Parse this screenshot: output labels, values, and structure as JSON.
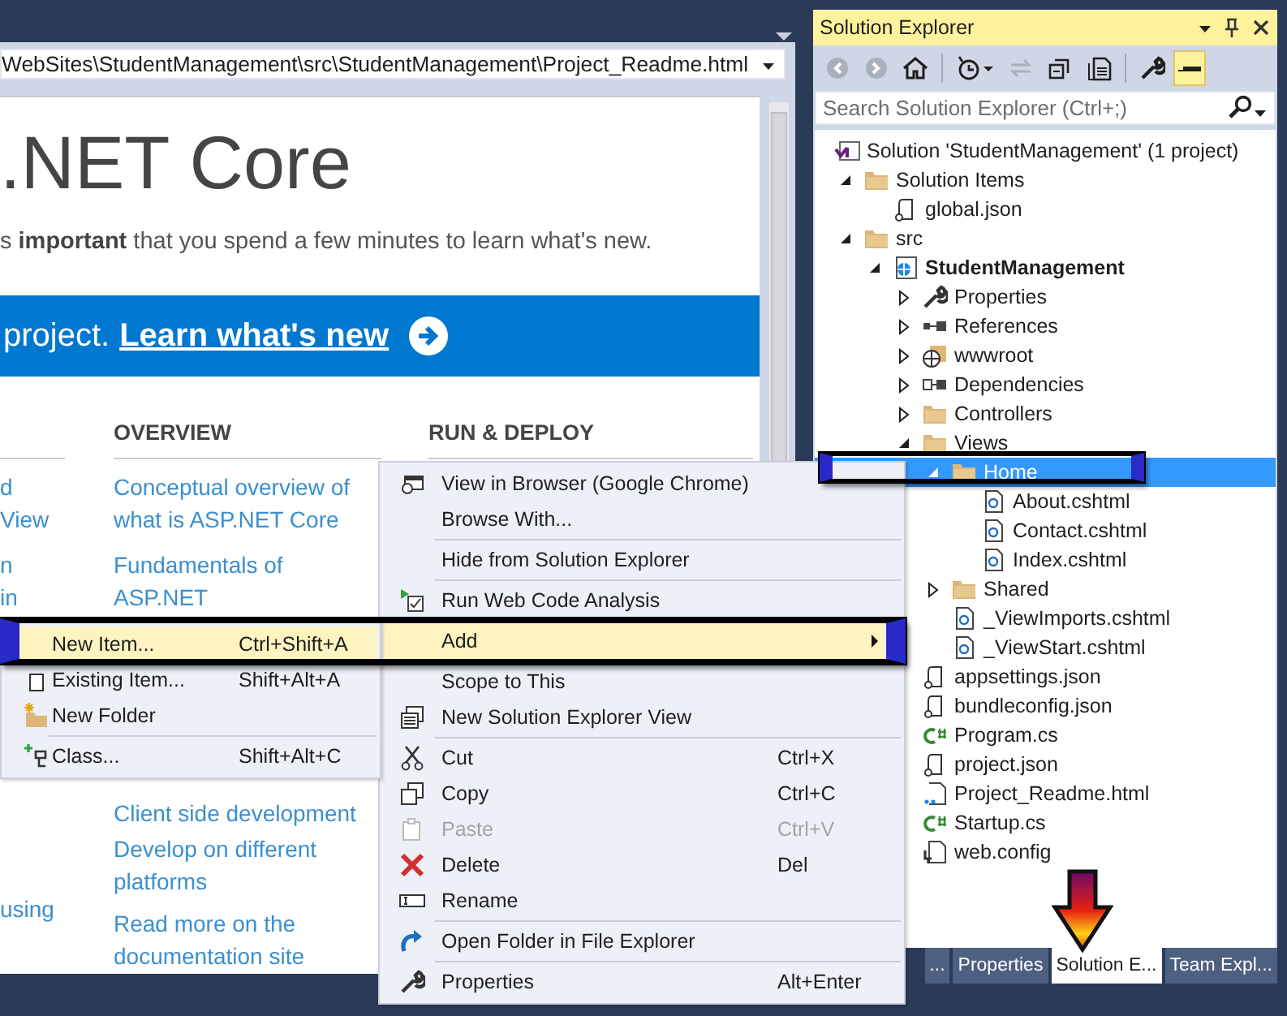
{
  "document": {
    "address_bar": {
      "value": "WebSites\\StudentManagement\\src\\StudentManagement\\Project_Readme.html"
    },
    "page": {
      "heading": ".NET Core",
      "intro": "s **important** that you spend a few minutes to learn what's new.",
      "banner": {
        "text": "project.",
        "link": "Learn what's new"
      },
      "left_fragments": [
        "d View",
        "n",
        "in",
        "using"
      ],
      "columns": [
        {
          "heading": "OVERVIEW",
          "links": [
            "Conceptual overview of what is ASP.NET Core",
            "Fundamentals of ASP.NET",
            "Client side development",
            "Develop on different platforms",
            "Read more on the documentation site"
          ]
        },
        {
          "heading": "RUN & DEPLOY"
        }
      ]
    }
  },
  "solution_explorer": {
    "title": "Solution Explorer",
    "search": {
      "placeholder": "Search Solution Explorer (Ctrl+;)"
    },
    "toolbar_groups": [
      [
        {
          "kind": "back",
          "disabled": true,
          "selected": false
        },
        {
          "kind": "forward",
          "disabled": true,
          "selected": false
        },
        {
          "kind": "home",
          "disabled": false,
          "selected": false
        }
      ],
      [
        {
          "kind": "history",
          "disabled": false,
          "selected": false
        },
        {
          "kind": "sync",
          "disabled": true,
          "selected": false
        },
        {
          "kind": "collapse",
          "disabled": false,
          "selected": false
        },
        {
          "kind": "show_all",
          "disabled": false,
          "selected": false
        }
      ],
      [
        {
          "kind": "properties",
          "disabled": false,
          "selected": false
        },
        {
          "kind": "preview",
          "disabled": false,
          "selected": true
        }
      ]
    ],
    "tree": [
      {
        "label": "Solution 'StudentManagement' (1 project)",
        "kind": "solution",
        "selected": false,
        "children": [
          {
            "label": "Solution Items",
            "kind": "folder",
            "selected": false,
            "expanded": true,
            "children": [
              {
                "label": "global.json",
                "kind": "json",
                "selected": false
              }
            ]
          },
          {
            "label": "src",
            "kind": "folder",
            "selected": false,
            "expanded": true,
            "children": [
              {
                "label": "StudentManagement",
                "kind": "project",
                "selected": false,
                "expanded": true,
                "children": [
                  {
                    "label": "Properties",
                    "kind": "wrench",
                    "selected": false,
                    "expanded": false
                  },
                  {
                    "label": "References",
                    "kind": "references",
                    "selected": false,
                    "expanded": false
                  },
                  {
                    "label": "wwwroot",
                    "kind": "globe_folder",
                    "selected": false,
                    "expanded": false
                  },
                  {
                    "label": "Dependencies",
                    "kind": "dependencies",
                    "selected": false,
                    "expanded": false
                  },
                  {
                    "label": "Controllers",
                    "kind": "folder",
                    "selected": false,
                    "expanded": false
                  },
                  {
                    "label": "Views",
                    "kind": "folder",
                    "selected": false,
                    "expanded": true,
                    "children": [
                      {
                        "label": "Home",
                        "kind": "folder",
                        "selected": true,
                        "expanded": true,
                        "children": [
                          {
                            "label": "About.cshtml",
                            "kind": "cshtml",
                            "selected": false
                          },
                          {
                            "label": "Contact.cshtml",
                            "kind": "cshtml",
                            "selected": false
                          },
                          {
                            "label": "Index.cshtml",
                            "kind": "cshtml",
                            "selected": false
                          }
                        ]
                      },
                      {
                        "label": "Shared",
                        "kind": "folder",
                        "selected": false,
                        "expanded": false
                      },
                      {
                        "label": "_ViewImports.cshtml",
                        "kind": "cshtml",
                        "selected": false
                      },
                      {
                        "label": "_ViewStart.cshtml",
                        "kind": "cshtml",
                        "selected": false
                      }
                    ]
                  },
                  {
                    "label": "appsettings.json",
                    "kind": "json",
                    "selected": false
                  },
                  {
                    "label": "bundleconfig.json",
                    "kind": "json",
                    "selected": false
                  },
                  {
                    "label": "Program.cs",
                    "kind": "cs",
                    "selected": false
                  },
                  {
                    "label": "project.json",
                    "kind": "json",
                    "selected": false
                  },
                  {
                    "label": "Project_Readme.html",
                    "kind": "html",
                    "selected": false
                  },
                  {
                    "label": "Startup.cs",
                    "kind": "cs",
                    "selected": false
                  },
                  {
                    "label": "web.config",
                    "kind": "config",
                    "selected": false
                  }
                ]
              }
            ]
          }
        ]
      }
    ],
    "tabs": [
      {
        "label": "...",
        "selected": false
      },
      {
        "label": "Properties",
        "selected": false
      },
      {
        "label": "Solution E...",
        "selected": true
      },
      {
        "label": "Team Expl...",
        "selected": false
      }
    ]
  },
  "context_menu": {
    "items": [
      {
        "kind": "item",
        "label": "View in Browser (Google Chrome)",
        "selected": false,
        "disabled": false
      },
      {
        "kind": "item",
        "label": "Browse With...",
        "selected": false,
        "disabled": false
      },
      {
        "kind": "separator"
      },
      {
        "kind": "item",
        "label": "Hide from Solution Explorer",
        "selected": false,
        "disabled": false
      },
      {
        "kind": "separator"
      },
      {
        "kind": "item",
        "label": "Run Web Code Analysis",
        "selected": false,
        "disabled": false
      },
      {
        "kind": "separator"
      },
      {
        "kind": "item",
        "label": "Add",
        "selected": true,
        "disabled": false,
        "submenu": true
      },
      {
        "kind": "separator"
      },
      {
        "kind": "item",
        "label": "Scope to This",
        "selected": false,
        "disabled": false
      },
      {
        "kind": "item",
        "label": "New Solution Explorer View",
        "selected": false,
        "disabled": false
      },
      {
        "kind": "separator"
      },
      {
        "kind": "item",
        "label": "Cut",
        "shortcut": "Ctrl+X",
        "selected": false,
        "disabled": false
      },
      {
        "kind": "item",
        "label": "Copy",
        "shortcut": "Ctrl+C",
        "selected": false,
        "disabled": false
      },
      {
        "kind": "item",
        "label": "Paste",
        "shortcut": "Ctrl+V",
        "selected": false,
        "disabled": true
      },
      {
        "kind": "item",
        "label": "Delete",
        "shortcut": "Del",
        "selected": false,
        "disabled": false
      },
      {
        "kind": "item",
        "label": "Rename",
        "selected": false,
        "disabled": false
      },
      {
        "kind": "separator"
      },
      {
        "kind": "item",
        "label": "Open Folder in File Explorer",
        "selected": false,
        "disabled": false
      },
      {
        "kind": "separator"
      },
      {
        "kind": "item",
        "label": "Properties",
        "shortcut": "Alt+Enter",
        "selected": false,
        "disabled": false
      }
    ]
  },
  "add_submenu": {
    "items": [
      {
        "kind": "item",
        "label": "New Item...",
        "shortcut": "Ctrl+Shift+A",
        "selected": true,
        "disabled": false
      },
      {
        "kind": "item",
        "label": "Existing Item...",
        "shortcut": "Shift+Alt+A",
        "selected": false,
        "disabled": false
      },
      {
        "kind": "item",
        "label": "New Folder",
        "selected": false,
        "disabled": false
      },
      {
        "kind": "separator"
      },
      {
        "kind": "item",
        "label": "Class...",
        "shortcut": "Shift+Alt+C",
        "selected": false,
        "disabled": false
      }
    ]
  }
}
